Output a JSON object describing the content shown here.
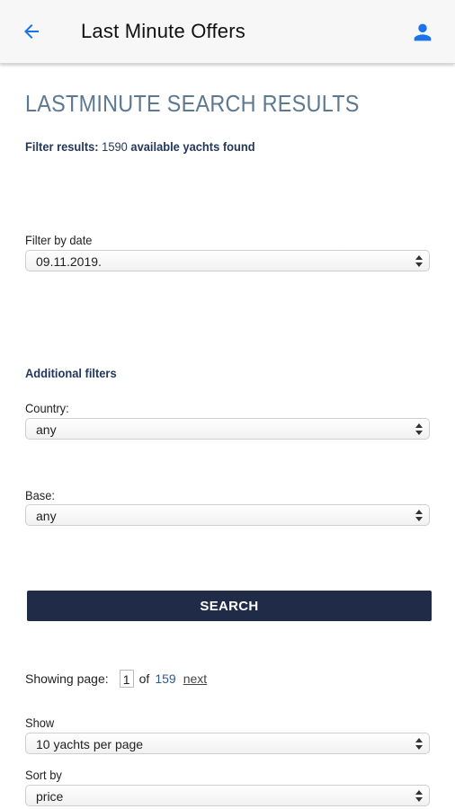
{
  "header": {
    "title": "Last Minute Offers",
    "back_icon": "arrow-left-icon",
    "user_icon": "user-icon",
    "accent_color": "#1a73e8"
  },
  "main": {
    "heading": "LASTMINUTE SEARCH RESULTS",
    "filter_results_label": "Filter results:",
    "result_count": "1590",
    "result_suffix": "available yachts found",
    "filter_by_date": {
      "label": "Filter by date",
      "value": "09.11.2019."
    },
    "additional_filters_label": "Additional filters",
    "country": {
      "label": "Country:",
      "value": "any"
    },
    "base": {
      "label": "Base:",
      "value": "any"
    },
    "search_button": "SEARCH",
    "pager": {
      "showing_label": "Showing page:",
      "current_page": "1",
      "of_label": "of",
      "total_pages": "159",
      "next_label": "next"
    },
    "show": {
      "label": "Show",
      "value": "10 yachts per page"
    },
    "sort_by": {
      "label": "Sort by",
      "value": "price"
    }
  },
  "colors": {
    "heading": "#5d7891",
    "navy": "#23385a",
    "button": "#1f2b47"
  }
}
